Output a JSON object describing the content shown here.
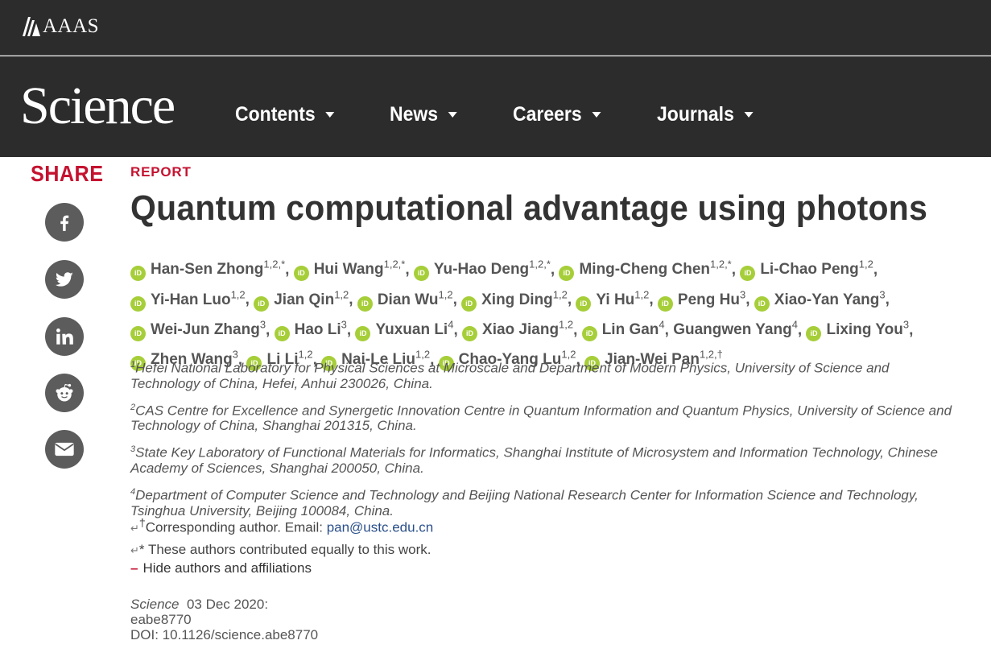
{
  "header": {
    "org_name": "AAAS",
    "logo_text": "Science",
    "nav": [
      {
        "label": "Contents"
      },
      {
        "label": "News"
      },
      {
        "label": "Careers"
      },
      {
        "label": "Journals"
      }
    ]
  },
  "share": {
    "title": "SHARE",
    "buttons": [
      "facebook-icon",
      "twitter-icon",
      "linkedin-icon",
      "reddit-icon",
      "email-icon"
    ]
  },
  "article": {
    "type": "REPORT",
    "title": "Quantum computational advantage using photons",
    "orcid_badge": "iD",
    "authors": [
      {
        "name": "Han-Sen Zhong",
        "sup": "1,2,*"
      },
      {
        "name": "Hui Wang",
        "sup": "1,2,*"
      },
      {
        "name": "Yu-Hao Deng",
        "sup": "1,2,*"
      },
      {
        "name": "Ming-Cheng Chen",
        "sup": "1,2,*"
      },
      {
        "name": "Li-Chao Peng",
        "sup": "1,2"
      },
      {
        "name": "Yi-Han Luo",
        "sup": "1,2"
      },
      {
        "name": "Jian Qin",
        "sup": "1,2"
      },
      {
        "name": "Dian Wu",
        "sup": "1,2"
      },
      {
        "name": "Xing Ding",
        "sup": "1,2"
      },
      {
        "name": "Yi Hu",
        "sup": "1,2"
      },
      {
        "name": "Peng Hu",
        "sup": "3"
      },
      {
        "name": "Xiao-Yan Yang",
        "sup": "3"
      },
      {
        "name": "Wei-Jun Zhang",
        "sup": "3"
      },
      {
        "name": "Hao Li",
        "sup": "3"
      },
      {
        "name": "Yuxuan Li",
        "sup": "4"
      },
      {
        "name": "Xiao Jiang",
        "sup": "1,2"
      },
      {
        "name": "Lin Gan",
        "sup": "4"
      },
      {
        "name": "Guangwen Yang",
        "sup": "4",
        "no_orcid": true
      },
      {
        "name": "Lixing You",
        "sup": "3"
      },
      {
        "name": "Zhen Wang",
        "sup": "3"
      },
      {
        "name": "Li Li",
        "sup": "1,2"
      },
      {
        "name": "Nai-Le Liu",
        "sup": "1,2"
      },
      {
        "name": "Chao-Yang Lu",
        "sup": "1,2"
      },
      {
        "name": "Jian-Wei Pan",
        "sup": "1,2,†"
      }
    ],
    "affiliations": [
      {
        "num": "1",
        "text": "Hefei National Laboratory for Physical Sciences at Microscale and Department of Modern Physics, University of Science and Technology of China, Hefei, Anhui 230026, China."
      },
      {
        "num": "2",
        "text": "CAS Centre for Excellence and Synergetic Innovation Centre in Quantum Information and Quantum Physics, University of Science and Technology of China, Shanghai 201315, China."
      },
      {
        "num": "3",
        "text": "State Key Laboratory of Functional Materials for Informatics, Shanghai Institute of Microsystem and Information Technology, Chinese Academy of Sciences, Shanghai 200050, China."
      },
      {
        "num": "4",
        "text": "Department of Computer Science and Technology and Beijing National Research Center for Information Science and Technology, Tsinghua University, Beijing 100084, China."
      }
    ],
    "corresponding": {
      "mark": "†",
      "text": "Corresponding author. Email: ",
      "email": "pan@ustc.edu.cn"
    },
    "equal_note": "* These authors contributed equally to this work.",
    "hide_toggle": {
      "symbol": "–",
      "label": "Hide authors and affiliations"
    },
    "citation": {
      "journal": "Science",
      "date": "03 Dec 2020:",
      "article_id": "eabe8770",
      "doi": "DOI: 10.1126/science.abe8770"
    }
  },
  "colors": {
    "header_bg": "#2c2c2c",
    "accent_red": "#c41230",
    "orcid_green": "#a6ce39",
    "share_icon_bg": "#5c5c5c",
    "link_blue": "#2a4f8a"
  }
}
